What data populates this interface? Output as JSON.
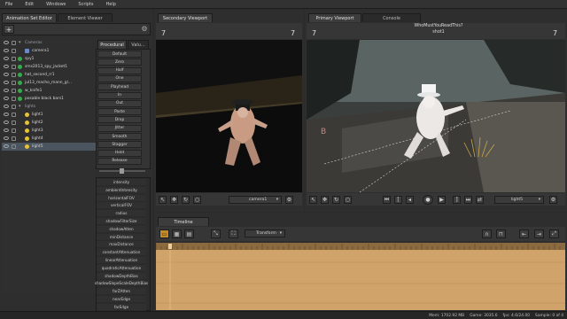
{
  "menu": [
    "File",
    "Edit",
    "Windows",
    "Scripts",
    "Help"
  ],
  "left_tabs": [
    "Animation Set Editor",
    "Element Viewer"
  ],
  "add_button": "+",
  "tree": [
    {
      "label": "Cameras",
      "type": "group"
    },
    {
      "label": "camera1",
      "type": "camera"
    },
    {
      "label": "spy1",
      "type": "item"
    },
    {
      "label": "sms2013_spy_jacket1",
      "type": "item"
    },
    {
      "label": "hat_second_rr1",
      "type": "item"
    },
    {
      "label": "jul13_macho_mann_gl...",
      "type": "item"
    },
    {
      "label": "w_knife1",
      "type": "item"
    },
    {
      "label": "posable black bars1",
      "type": "item"
    },
    {
      "label": "lights",
      "type": "group"
    },
    {
      "label": "light1",
      "type": "light"
    },
    {
      "label": "light2",
      "type": "light"
    },
    {
      "label": "light3",
      "type": "light"
    },
    {
      "label": "light4",
      "type": "light"
    },
    {
      "label": "light5",
      "type": "light"
    }
  ],
  "proc_tabs": [
    "Procedural",
    "Valu..."
  ],
  "proc_buttons": [
    "Default",
    "Zero",
    "Half",
    "One",
    "Playhead",
    "In",
    "Out",
    "Paste",
    "Drop",
    "Jitter",
    "Smooth",
    "Stagger",
    "Hold",
    "Release"
  ],
  "attributes": [
    "intensity",
    "ambientIntensity",
    "horizontalFOV",
    "verticalFOV",
    "radius",
    "shadowFilterSize",
    "shadowAtten",
    "minDistance",
    "maxDistance",
    "constantAttenuation",
    "linearAttenuation",
    "quadraticAttenuation",
    "shadowDepthBias",
    "shadowSlopeScaleDepthBias",
    "farZAtten",
    "nearEdge",
    "farEdge"
  ],
  "secondary": {
    "tab": "Secondary Viewport",
    "num_left": "7",
    "num_right": "7",
    "camera": "camera1"
  },
  "primary": {
    "tabs": [
      "Primary Viewport",
      "Console"
    ],
    "num_left": "7",
    "num_right": "7",
    "caption1": "WhoMustYouReadThis?",
    "caption2": "shot1",
    "light": "light5"
  },
  "timeline": {
    "tab": "Timeline",
    "mode": "Transform"
  },
  "status": {
    "mem": "Mem: 1702.92 MB",
    "game": "Game: 3035.6",
    "fps": "fps: 4.6/24.00",
    "sample": "Sample: 0 of 4"
  },
  "colors": {
    "accent": "#e5a03a",
    "timeline_fill": "#cfa36a",
    "selected_row": "#4a5560"
  }
}
